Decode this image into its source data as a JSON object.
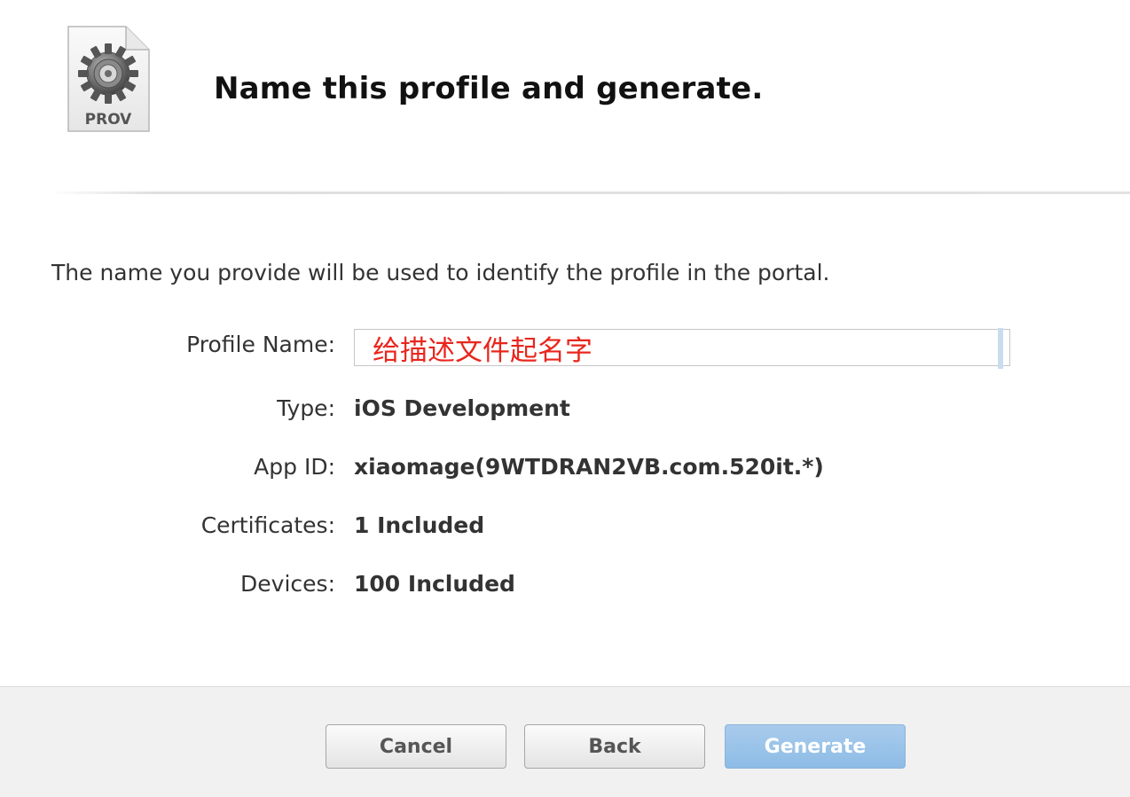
{
  "header": {
    "title": "Name this profile and generate.",
    "icon": {
      "name": "provisioning-profile-icon",
      "badge": "PROV"
    }
  },
  "intro_text": "The name you provide will be used to identify the profile in the portal.",
  "form": {
    "profile_name": {
      "label": "Profile Name:",
      "value": "给描述文件起名字"
    },
    "type": {
      "label": "Type:",
      "value": "iOS Development"
    },
    "app_id": {
      "label": "App ID:",
      "value": "xiaomage(9WTDRAN2VB.com.520it.*)"
    },
    "certificates": {
      "label": "Certificates:",
      "value": "1 Included"
    },
    "devices": {
      "label": "Devices:",
      "value": "100 Included"
    }
  },
  "footer": {
    "cancel_label": "Cancel",
    "back_label": "Back",
    "generate_label": "Generate"
  },
  "colors": {
    "input_text": "#e8261d",
    "generate_button": "#8dbce6",
    "footer_background": "#f1f1f1"
  }
}
